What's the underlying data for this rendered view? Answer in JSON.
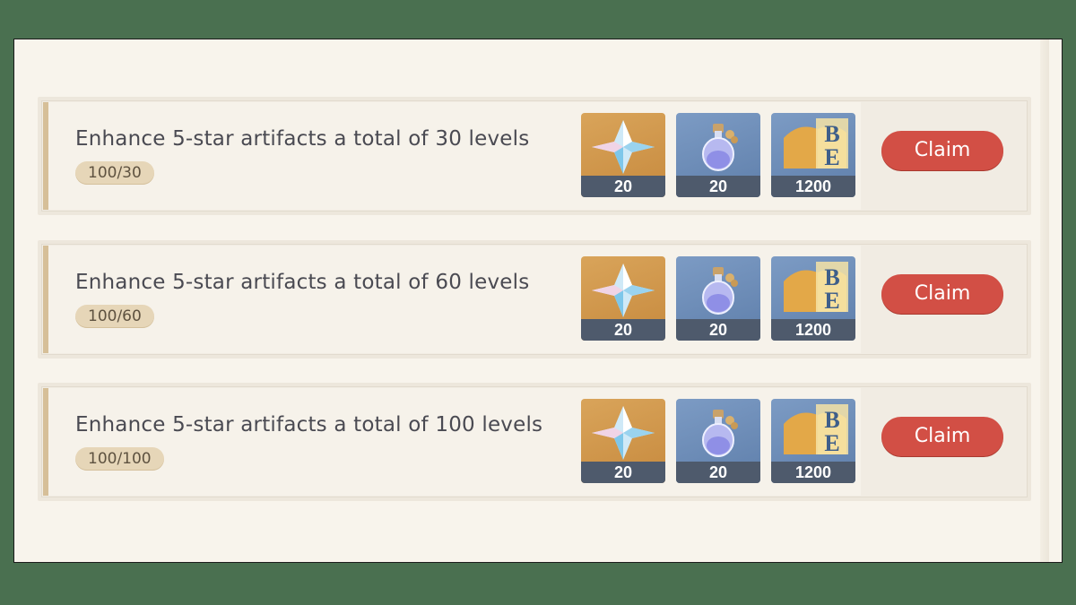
{
  "tasks": [
    {
      "title": "Enhance 5-star artifacts a total of 30 levels",
      "progress": "100/30",
      "rewards": [
        {
          "icon": "primogem-icon",
          "qty": "20"
        },
        {
          "icon": "potion-icon",
          "qty": "20"
        },
        {
          "icon": "exp-book-icon",
          "qty": "1200"
        }
      ],
      "claim_label": "Claim"
    },
    {
      "title": "Enhance 5-star artifacts a total of 60 levels",
      "progress": "100/60",
      "rewards": [
        {
          "icon": "primogem-icon",
          "qty": "20"
        },
        {
          "icon": "potion-icon",
          "qty": "20"
        },
        {
          "icon": "exp-book-icon",
          "qty": "1200"
        }
      ],
      "claim_label": "Claim"
    },
    {
      "title": "Enhance 5-star artifacts a total of 100 levels",
      "progress": "100/100",
      "rewards": [
        {
          "icon": "primogem-icon",
          "qty": "20"
        },
        {
          "icon": "potion-icon",
          "qty": "20"
        },
        {
          "icon": "exp-book-icon",
          "qty": "1200"
        }
      ],
      "claim_label": "Claim"
    }
  ],
  "colors": {
    "claim_button": "#d24f45",
    "progress_pill": "#e6d6b8",
    "reward_gold": "#d9a45a",
    "reward_blue": "#7c9bc4"
  }
}
